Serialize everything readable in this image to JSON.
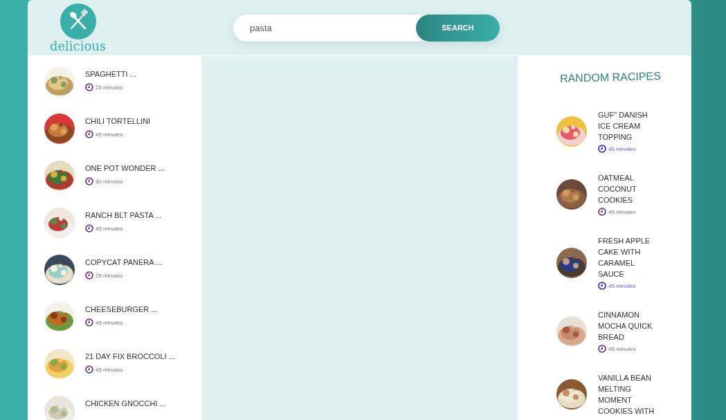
{
  "logo": {
    "text": "delicious"
  },
  "search": {
    "value": "pasta",
    "button": "SEARCH"
  },
  "results": [
    {
      "title": "SPAGHETTI ...",
      "minutes": "25 minutes",
      "visited": true
    },
    {
      "title": "CHILI TORTELLINI",
      "minutes": "45 minutes",
      "visited": true
    },
    {
      "title": "ONE POT WONDER ...",
      "minutes": "30 minutes",
      "visited": true
    },
    {
      "title": "RANCH BLT PASTA ...",
      "minutes": "45 minutes",
      "visited": true
    },
    {
      "title": "COPYCAT PANERA ...",
      "minutes": "25 minutes",
      "visited": true
    },
    {
      "title": "CHEESEBURGER ...",
      "minutes": "45 minutes",
      "visited": true
    },
    {
      "title": "21 DAY FIX BROCCOLI ...",
      "minutes": "45 minutes",
      "visited": true
    },
    {
      "title": "CHICKEN GNOCCHI ..."
    }
  ],
  "random": {
    "heading": "RANDOM RACIPES",
    "items": [
      {
        "title": "GUF\" DANISH ICE CREAM TOPPING",
        "minutes": "45 minutes",
        "visited": false
      },
      {
        "title": "OATMEAL COCONUT COOKIES",
        "minutes": "45 minutes",
        "visited": true
      },
      {
        "title": "FRESH APPLE CAKE WITH CARAMEL SAUCE",
        "minutes": "45 minutes",
        "visited": false
      },
      {
        "title": "CINNAMON MOCHA QUICK BREAD",
        "minutes": "45 minutes",
        "visited": true
      },
      {
        "title": "VANILLA BEAN MELTING MOMENT COOKIES WITH"
      }
    ]
  }
}
